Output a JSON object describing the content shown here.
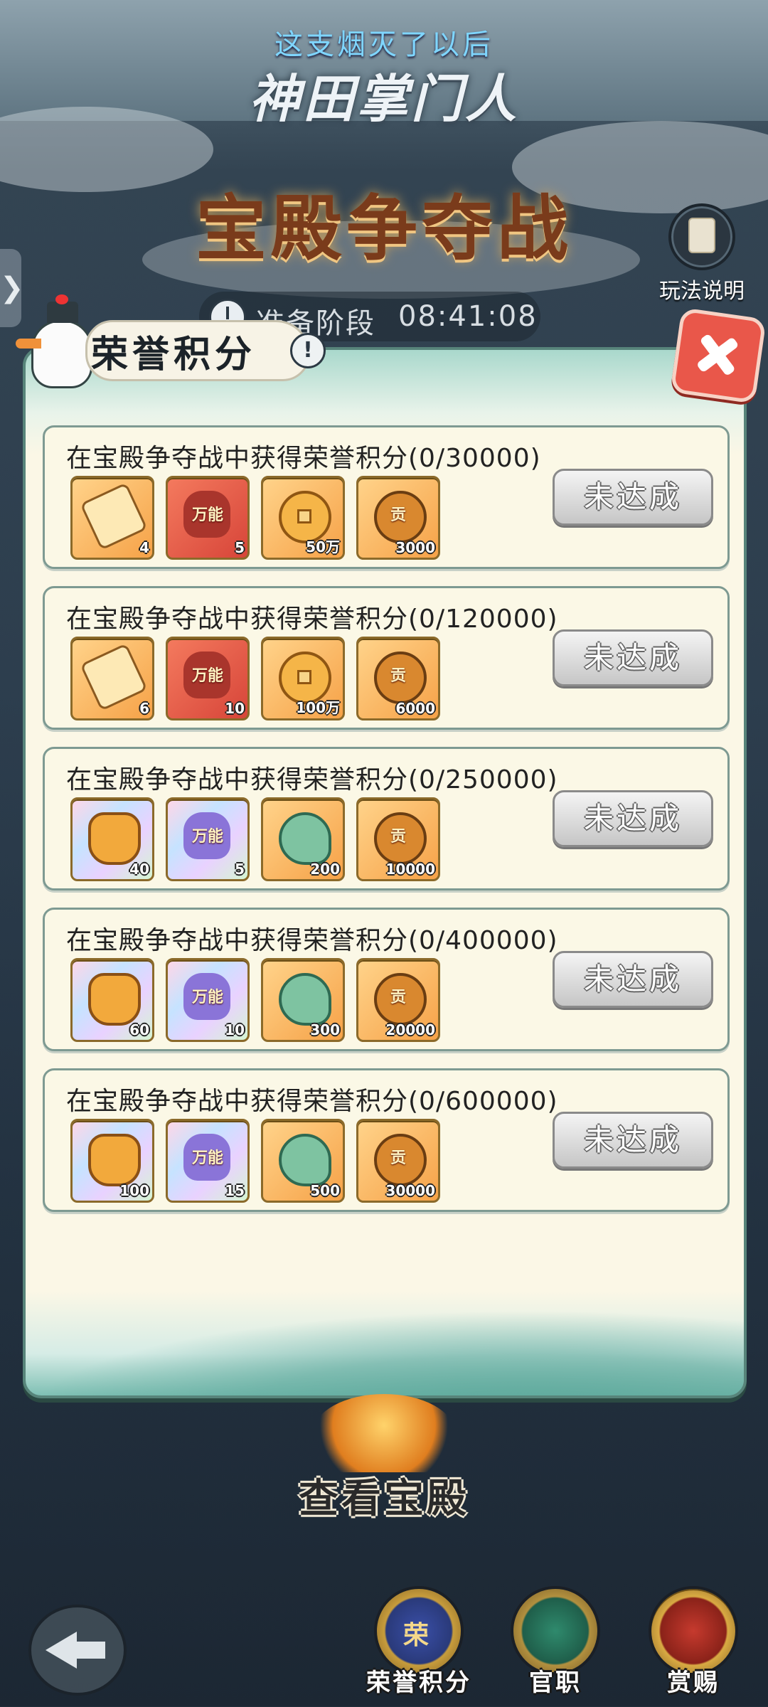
{
  "header": {
    "banner_text": "这支烟灭了以后",
    "logo_text": "神田掌门人",
    "main_title": "宝殿争夺战",
    "rules_label": "玩法说明",
    "side_tab_glyph": "❯"
  },
  "phase": {
    "label": "准备阶段",
    "time": "08:41:08"
  },
  "panel": {
    "title": "荣誉积分",
    "info_glyph": "!",
    "status_label": "未达成",
    "tasks": [
      {
        "title": "在宝殿争夺战中获得荣誉积分(0/30000)",
        "rewards": [
          {
            "icon": "ticket-icon",
            "style": "orange",
            "glyph": "",
            "qty": "4"
          },
          {
            "icon": "universal-hero-icon",
            "style": "red",
            "glyph": "万能",
            "qty": "5"
          },
          {
            "icon": "copper-coin-icon",
            "style": "orange",
            "glyph": "",
            "qty": "50万"
          },
          {
            "icon": "tribute-token-icon",
            "style": "orange",
            "glyph": "贡",
            "qty": "3000"
          }
        ]
      },
      {
        "title": "在宝殿争夺战中获得荣誉积分(0/120000)",
        "rewards": [
          {
            "icon": "ticket-icon",
            "style": "orange",
            "glyph": "",
            "qty": "6"
          },
          {
            "icon": "universal-hero-icon",
            "style": "red",
            "glyph": "万能",
            "qty": "10"
          },
          {
            "icon": "copper-coin-icon",
            "style": "orange",
            "glyph": "",
            "qty": "100万"
          },
          {
            "icon": "tribute-token-icon",
            "style": "orange",
            "glyph": "贡",
            "qty": "6000"
          }
        ]
      },
      {
        "title": "在宝殿争夺战中获得荣誉积分(0/250000)",
        "rewards": [
          {
            "icon": "gold-ingot-icon",
            "style": "rainbow",
            "glyph": "",
            "qty": "40"
          },
          {
            "icon": "universal-hero-icon",
            "style": "rainbow",
            "glyph": "万能",
            "qty": "5"
          },
          {
            "icon": "jade-dragon-icon",
            "style": "orange",
            "glyph": "",
            "qty": "200"
          },
          {
            "icon": "tribute-token-icon",
            "style": "orange",
            "glyph": "贡",
            "qty": "10000"
          }
        ]
      },
      {
        "title": "在宝殿争夺战中获得荣誉积分(0/400000)",
        "rewards": [
          {
            "icon": "gold-ingot-icon",
            "style": "rainbow",
            "glyph": "",
            "qty": "60"
          },
          {
            "icon": "universal-hero-icon",
            "style": "rainbow",
            "glyph": "万能",
            "qty": "10"
          },
          {
            "icon": "jade-dragon-icon",
            "style": "orange",
            "glyph": "",
            "qty": "300"
          },
          {
            "icon": "tribute-token-icon",
            "style": "orange",
            "glyph": "贡",
            "qty": "20000"
          }
        ]
      },
      {
        "title": "在宝殿争夺战中获得荣誉积分(0/600000)",
        "rewards": [
          {
            "icon": "gold-ingot-icon",
            "style": "rainbow",
            "glyph": "",
            "qty": "100"
          },
          {
            "icon": "universal-hero-icon",
            "style": "rainbow",
            "glyph": "万能",
            "qty": "15"
          },
          {
            "icon": "jade-dragon-icon",
            "style": "orange",
            "glyph": "",
            "qty": "500"
          },
          {
            "icon": "tribute-token-icon",
            "style": "orange",
            "glyph": "贡",
            "qty": "30000"
          }
        ]
      }
    ]
  },
  "view_hall": {
    "label": "查看宝殿"
  },
  "bottom_nav": [
    {
      "label": "荣誉积分",
      "glyph": "荣",
      "icon": "honor-points-icon",
      "style": "honor"
    },
    {
      "label": "官职",
      "glyph": "",
      "icon": "official-post-icon",
      "style": "office"
    },
    {
      "label": "赏赐",
      "glyph": "",
      "icon": "reward-chest-icon",
      "style": "reward"
    }
  ],
  "colors": {
    "panel_bg": "#fbf8e6",
    "accent_teal": "#57847a",
    "close_red": "#e9574a",
    "title_brown": "#7a3b1b"
  }
}
